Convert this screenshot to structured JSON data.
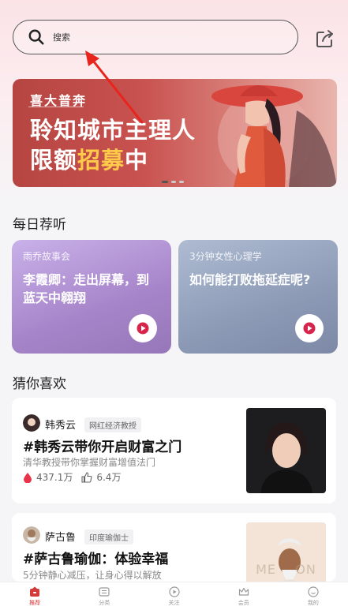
{
  "search": {
    "placeholder": "搜索"
  },
  "banner": {
    "tag": "喜大普奔",
    "line1": "聆知城市主理人",
    "line2_a": "限额",
    "line2_b": "招募",
    "line2_c": "中",
    "carousel_active_index": 0,
    "carousel_count": 3
  },
  "daily": {
    "title": "每日荐听",
    "cards": [
      {
        "category": "雨乔故事会",
        "title": "李霞卿：走出屏幕，到蓝天中翱翔"
      },
      {
        "category": "3分钟女性心理学",
        "title": "如何能打败拖延症呢?"
      }
    ]
  },
  "guess": {
    "title": "猜你喜欢",
    "items": [
      {
        "author": "韩秀云",
        "badge": "网红经济教授",
        "title": "#韩秀云带你开启财富之门",
        "desc": "清华教授带你掌握财富增值法门",
        "plays": "437.1万",
        "likes": "6.4万"
      },
      {
        "author": "萨古鲁",
        "badge": "印度瑜伽士",
        "title": "#萨古鲁瑜伽：体验幸福",
        "desc": "5分钟静心减压，让身心得以解放",
        "thumb_text": "ME    ON"
      }
    ]
  },
  "tabbar": {
    "items": [
      {
        "label": "推荐",
        "icon": "home-icon",
        "active": true
      },
      {
        "label": "分类",
        "icon": "category-icon",
        "active": false
      },
      {
        "label": "关注",
        "icon": "follow-icon",
        "active": false
      },
      {
        "label": "会员",
        "icon": "vip-crown-icon",
        "active": false
      },
      {
        "label": "我的",
        "icon": "profile-icon",
        "active": false
      }
    ]
  },
  "colors": {
    "accent": "#d33a3a",
    "banner_red": "#c24a47",
    "highlight": "#ffc94a"
  }
}
